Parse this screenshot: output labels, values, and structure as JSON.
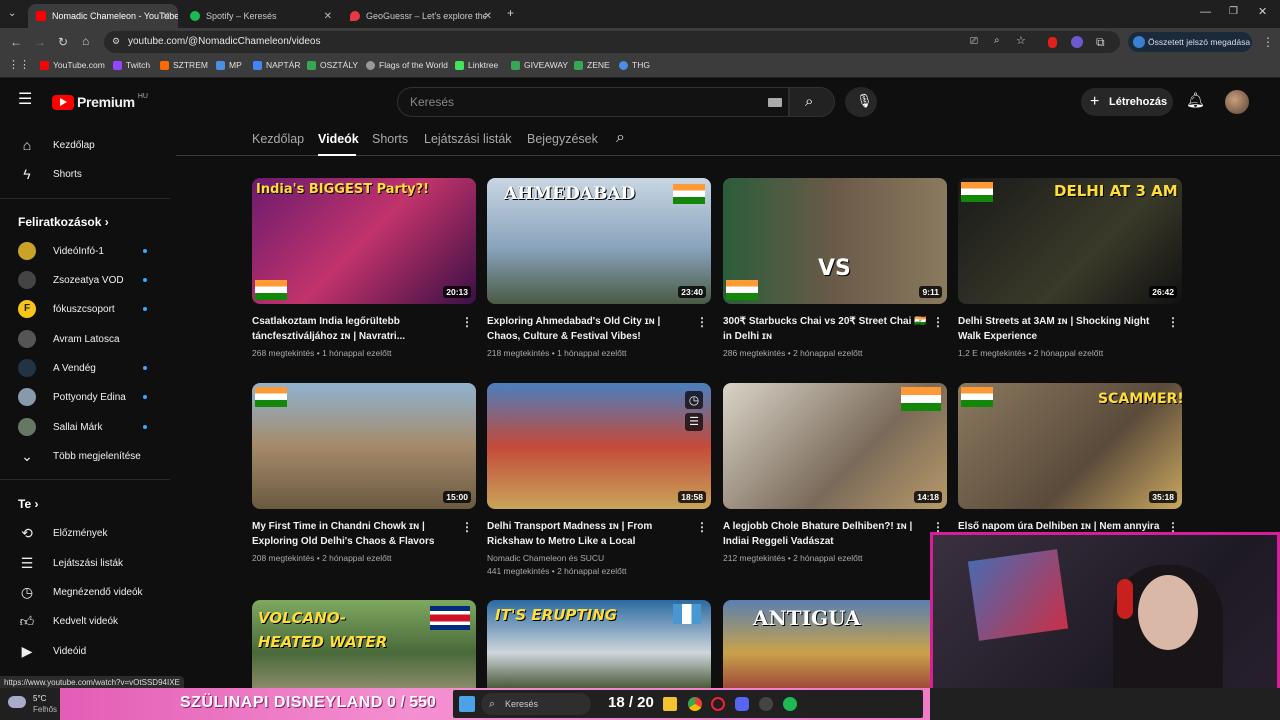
{
  "browser": {
    "tabs": [
      {
        "title": "Nomadic Chameleon - YouTube",
        "color": "#ff0000",
        "active": true
      },
      {
        "title": "Spotify – Keresés",
        "color": "#1db954",
        "active": false
      },
      {
        "title": "GeoGuessr – Let's explore the w...",
        "color": "#e63946",
        "active": false
      }
    ],
    "new_tab": "+",
    "url": "youtube.com/@NomadicChameleon/videos",
    "profile_label": "Összetett jelszó megadása",
    "bookmarks": [
      {
        "label": "YouTube.com",
        "color": "#ff0000"
      },
      {
        "label": "Twitch",
        "color": "#9146ff"
      },
      {
        "label": "SZTREM",
        "color": "#ff6a00"
      },
      {
        "label": "MP",
        "color": "#4a90e2"
      },
      {
        "label": "NAPTÁR",
        "color": "#4285f4"
      },
      {
        "label": "OSZTÁLY",
        "color": "#34a853"
      },
      {
        "label": "Flags of the World",
        "color": "#999999"
      },
      {
        "label": "Linktree",
        "color": "#43e55e"
      },
      {
        "label": "GIVEAWAY",
        "color": "#34a853"
      },
      {
        "label": "ZENE",
        "color": "#34a853"
      },
      {
        "label": "THG",
        "color": "#4a90e2"
      }
    ]
  },
  "youtube": {
    "logo": "Premium",
    "logo_region": "HU",
    "search_placeholder": "Keresés",
    "create_label": "Létrehozás",
    "sidebar": {
      "main": [
        {
          "label": "Kezdőlap",
          "icon": "home-icon"
        },
        {
          "label": "Shorts",
          "icon": "shorts-icon"
        }
      ],
      "subs_header": "Feliratkozások",
      "subs": [
        {
          "label": "VideóInfó-1",
          "color": "#c9a227"
        },
        {
          "label": "Zsozeatya VOD",
          "color": "#444"
        },
        {
          "label": "fókuszcsoport",
          "color": "#f5c518"
        },
        {
          "label": "Avram Latosca",
          "color": "#555"
        },
        {
          "label": "A Vendég",
          "color": "#223344"
        },
        {
          "label": "Pottyondy Edina",
          "color": "#8899aa"
        },
        {
          "label": "Sallai Márk",
          "color": "#667766"
        }
      ],
      "more": "Több megjelenítése",
      "you_header": "Te",
      "you": [
        {
          "label": "Előzmények",
          "icon": "history-icon"
        },
        {
          "label": "Lejátszási listák",
          "icon": "playlist-icon"
        },
        {
          "label": "Megnézendő videók",
          "icon": "watch-later-icon"
        },
        {
          "label": "Kedvelt videók",
          "icon": "like-icon"
        },
        {
          "label": "Videóid",
          "icon": "your-videos-icon"
        }
      ]
    },
    "channel_tabs": [
      "Kezdőlap",
      "Videók",
      "Shorts",
      "Lejátszási listák",
      "Bejegyzések"
    ],
    "videos": [
      {
        "title": "Csatlakoztam India legőrültebb táncfesztiváljához ɪɴ | Navratri...",
        "meta": "268 megtekintés • 1 hónappal ezelőtt",
        "duration": "20:13",
        "overlay": "India's BIGGEST Party?!",
        "bg": "linear-gradient(135deg,#6a1b6e,#c2336b,#3a1046)"
      },
      {
        "title": "Exploring Ahmedabad's Old City ɪɴ | Chaos, Culture & Festival Vibes!",
        "meta": "218 megtekintés • 1 hónappal ezelőtt",
        "duration": "23:40",
        "overlay": "AHMEDABAD",
        "bg": "linear-gradient(180deg,#c9d6e3,#8aa4bd 55%,#4a5a44)"
      },
      {
        "title": "300₹ Starbucks Chai vs 20₹ Street Chai 🇮🇳 in Delhi ɪɴ",
        "meta": "286 megtekintés • 2 hónappal ezelőtt",
        "duration": "9:11",
        "overlay": "VS",
        "bg": "linear-gradient(90deg,#2b5d3a,#6b5a48 50%,#8a7a5e)"
      },
      {
        "title": "Delhi Streets at 3AM ɪɴ | Shocking Night Walk Experience",
        "meta": "1,2 E megtekintés • 2 hónappal ezelőtt",
        "duration": "26:42",
        "overlay": "DELHI AT 3 AM",
        "bg": "linear-gradient(135deg,#1a1a1a,#3a3a2a 60%,#111)"
      },
      {
        "title": "My First Time in Chandni Chowk ɪɴ | Exploring Old Delhi's Chaos & Flavors",
        "meta": "208 megtekintés • 2 hónappal ezelőtt",
        "duration": "15:00",
        "overlay": "",
        "bg": "linear-gradient(180deg,#8fb2d0,#a58a6a 50%,#6a5a40)"
      },
      {
        "title": "Delhi Transport Madness ɪɴ | From Rickshaw to Metro Like a Local",
        "meta": "441 megtekintés • 2 hónappal ezelőtt",
        "channel": "Nomadic Chameleon és SUCU",
        "duration": "18:58",
        "overlay": "",
        "bg": "linear-gradient(180deg,#4a7fbf,#c34a3a 50%,#c9a55a)"
      },
      {
        "title": "A legjobb Chole Bhature Delhiben?! ɪɴ | Indiai Reggeli Vadászat",
        "meta": "212 megtekintés • 2 hónappal ezelőtt",
        "duration": "14:18",
        "overlay": "",
        "bg": "linear-gradient(135deg,#d9d4c8,#7a6a5a 60%,#b89a6a)"
      },
      {
        "title": "Első napom úra Delhiben ɪɴ | Nem annyira",
        "meta": "",
        "duration": "35:18",
        "overlay": "SCAMMER!",
        "bg": "linear-gradient(135deg,#8a7a60,#5a4a3a 60%,#caa860)"
      }
    ],
    "row3": [
      {
        "overlay": "VOLCANO-HEATED WATER",
        "bg": "linear-gradient(180deg,#7fa860,#4a6a3a 60%,#8a8a6a)"
      },
      {
        "overlay": "IT'S ERUPTING",
        "bg": "linear-gradient(180deg,#2a6aa0,#d0d6dc 60%,#4a5a3a)"
      },
      {
        "overlay": "ANTIGUA",
        "bg": "linear-gradient(180deg,#5a7fb0,#c9a24a 60%,#a04a3a)"
      }
    ]
  },
  "taskbar": {
    "weather_temp": "5°C",
    "weather_desc": "Felhős",
    "banner_title": "SZÜLINAPI DISNEYLAND",
    "banner_count": "0 / 550",
    "search": "Keresés",
    "counter": "18 / 20"
  },
  "status_url": "https://www.youtube.com/watch?v=vOtSSD94IXE"
}
